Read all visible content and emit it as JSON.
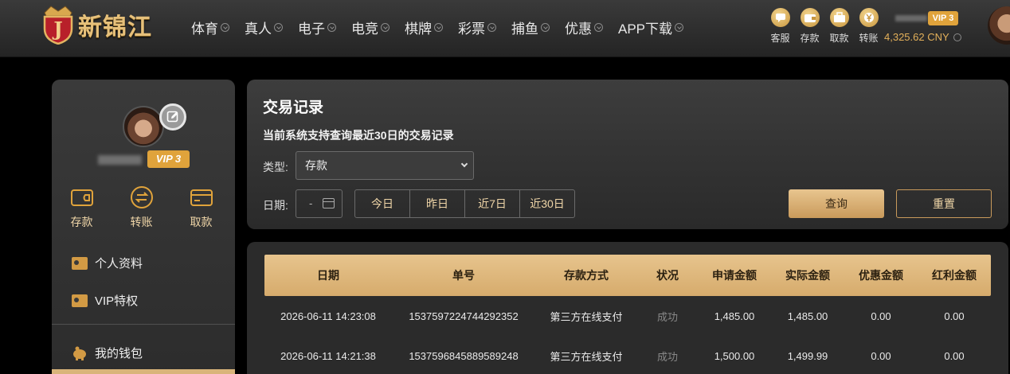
{
  "header": {
    "logo_text": "新锦江",
    "logo_letter": "J",
    "nav": [
      {
        "label": "体育"
      },
      {
        "label": "真人"
      },
      {
        "label": "电子"
      },
      {
        "label": "电竞"
      },
      {
        "label": "棋牌"
      },
      {
        "label": "彩票"
      },
      {
        "label": "捕鱼"
      },
      {
        "label": "优惠"
      },
      {
        "label": "APP下载"
      }
    ],
    "quick_actions": [
      {
        "label": "客服",
        "icon": "chat-icon"
      },
      {
        "label": "存款",
        "icon": "wallet-icon"
      },
      {
        "label": "取款",
        "icon": "briefcase-icon"
      },
      {
        "label": "转账",
        "icon": "yen-coin-icon"
      }
    ],
    "vip_label": "VIP 3",
    "balance": "4,325.62 CNY"
  },
  "sidebar": {
    "vip_label": "VIP 3",
    "actions": [
      {
        "label": "存款",
        "icon": "wallet-icon"
      },
      {
        "label": "转账",
        "icon": "transfer-icon"
      },
      {
        "label": "取款",
        "icon": "card-icon"
      }
    ],
    "menu": [
      {
        "label": "个人资料",
        "icon": "id-card-icon"
      },
      {
        "label": "VIP特权",
        "icon": "id-card-icon"
      },
      {
        "label": "我的钱包",
        "icon": "piggy-bank-icon"
      }
    ]
  },
  "records": {
    "title": "交易记录",
    "subtitle": "当前系统支持查询最近30日的交易记录",
    "type_label": "类型:",
    "type_value": "存款",
    "date_label": "日期:",
    "date_placeholder": "-",
    "ranges": [
      "今日",
      "昨日",
      "近7日",
      "近30日"
    ],
    "query_label": "查询",
    "reset_label": "重置"
  },
  "table": {
    "columns": [
      "日期",
      "单号",
      "存款方式",
      "状况",
      "申请金额",
      "实际金额",
      "优惠金额",
      "红利金额"
    ],
    "rows": [
      [
        "2026-06-11 14:23:08",
        "1537597224744292352",
        "第三方在线支付",
        "成功",
        "1,485.00",
        "1,485.00",
        "0.00",
        "0.00"
      ],
      [
        "2026-06-11 14:21:38",
        "1537596845889589248",
        "第三方在线支付",
        "成功",
        "1,500.00",
        "1,499.99",
        "0.00",
        "0.00"
      ]
    ]
  },
  "colors": {
    "accent_gold": "#e0a33b",
    "button_gold": "#d6ab6c",
    "panel": "#2b2b2b"
  }
}
